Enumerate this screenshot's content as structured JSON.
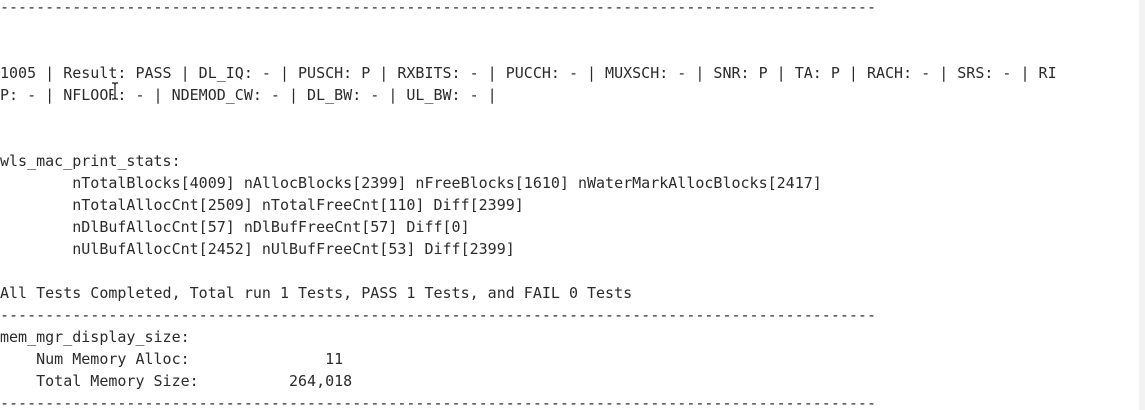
{
  "terminal": {
    "lines": [
      "-------------------------------------------------------------------------------------------------",
      "",
      "",
      "1005 | Result: PASS | DL_IQ: - | PUSCH: P | RXBITS: - | PUCCH: - | MUXSCH: - | SNR: P | TA: P | RACH: - | SRS: - | RI",
      "P: - | NFLOOR: - | NDEMOD_CW: - | DL_BW: - | UL_BW: - |",
      "",
      "",
      "wls_mac_print_stats:",
      "        nTotalBlocks[4009] nAllocBlocks[2399] nFreeBlocks[1610] nWaterMarkAllocBlocks[2417]",
      "        nTotalAllocCnt[2509] nTotalFreeCnt[110] Diff[2399]",
      "        nDlBufAllocCnt[57] nDlBufFreeCnt[57] Diff[0]",
      "        nUlBufAllocCnt[2452] nUlBufFreeCnt[53] Diff[2399]",
      "",
      "All Tests Completed, Total run 1 Tests, PASS 1 Tests, and FAIL 0 Tests",
      "-------------------------------------------------------------------------------------------------",
      "mem_mgr_display_size:",
      "    Num Memory Alloc:               11",
      "    Total Memory Size:          264,018",
      "-------------------------------------------------------------------------------------------------"
    ]
  },
  "cursor": {
    "icon": "text-cursor-icon"
  },
  "colors": {
    "background": "#ffffff",
    "text": "#2b2b2b"
  }
}
